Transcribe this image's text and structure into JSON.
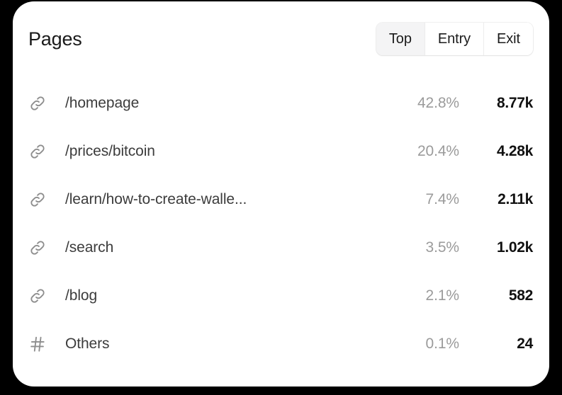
{
  "card": {
    "title": "Pages",
    "tabs": [
      {
        "label": "Top",
        "active": true
      },
      {
        "label": "Entry",
        "active": false
      },
      {
        "label": "Exit",
        "active": false
      }
    ],
    "rows": [
      {
        "icon": "link-icon",
        "label": "/homepage",
        "percent": "42.8%",
        "count": "8.77k"
      },
      {
        "icon": "link-icon",
        "label": "/prices/bitcoin",
        "percent": "20.4%",
        "count": "4.28k"
      },
      {
        "icon": "link-icon",
        "label": "/learn/how-to-create-walle...",
        "percent": "7.4%",
        "count": "2.11k"
      },
      {
        "icon": "link-icon",
        "label": "/search",
        "percent": "3.5%",
        "count": "1.02k"
      },
      {
        "icon": "link-icon",
        "label": "/blog",
        "percent": "2.1%",
        "count": "582"
      },
      {
        "icon": "hash-icon",
        "label": "Others",
        "percent": "0.1%",
        "count": "24"
      }
    ]
  },
  "colors": {
    "background": "#000000",
    "card": "#ffffff",
    "title": "#1a1a1a",
    "label": "#3c3c3c",
    "percent": "#9b9b9b",
    "count": "#111111",
    "icon": "#8d8d8d",
    "tab_active_bg": "#f4f4f5"
  }
}
